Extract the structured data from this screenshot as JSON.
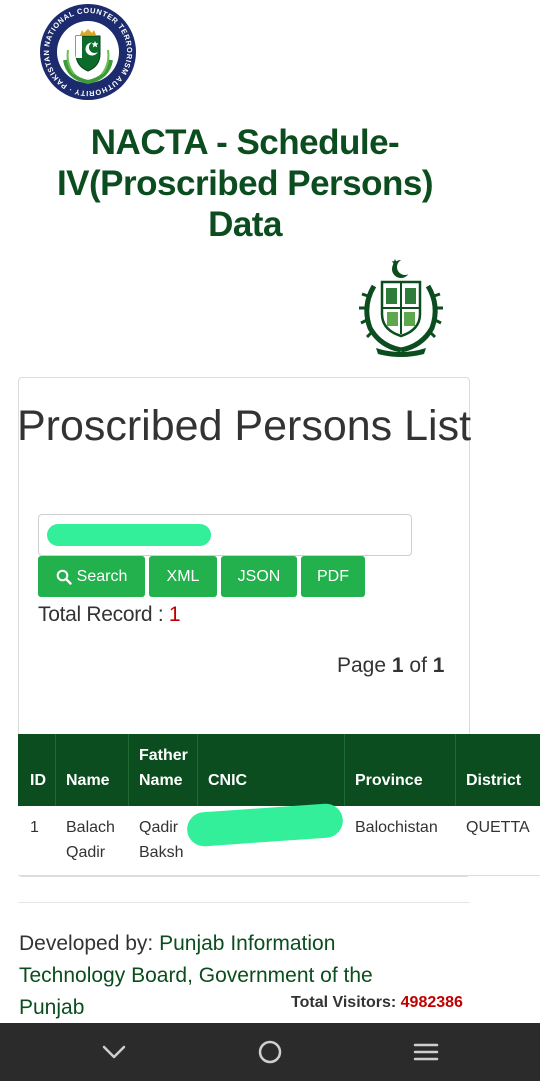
{
  "header": {
    "nacta_logo_text": "NATIONAL COUNTER TERRORISM AUTHORITY · PAKISTAN",
    "title": "NACTA - Schedule-IV(Proscribed Persons) Data"
  },
  "card": {
    "title": "Proscribed Persons List",
    "search": {
      "value": ""
    },
    "buttons": {
      "search": "Search",
      "xml": "XML",
      "json": "JSON",
      "pdf": "PDF"
    },
    "total_record_label": "Total Record : ",
    "total_record_value": "1",
    "pager": {
      "prefix": "Page ",
      "current": "1",
      "sep": " of ",
      "total": "1"
    }
  },
  "table": {
    "headers": {
      "id": "ID",
      "name": "Name",
      "father_top": "Father",
      "father_bottom": "Name",
      "cnic": "CNIC",
      "province": "Province",
      "district": "District"
    },
    "rows": [
      {
        "id": "1",
        "name_line1": "Balach",
        "name_line2": "Qadir",
        "father_line1": "Qadir",
        "father_line2": "Baksh",
        "cnic": "",
        "province": "Balochistan",
        "district": "QUETTA"
      }
    ]
  },
  "footer": {
    "developed_label": "Developed by: ",
    "developer": "Punjab Information Technology Board, Government of the Punjab",
    "visitors_label": "Total Visitors: ",
    "visitors_value": "4982386"
  },
  "colors": {
    "brand_green": "#0b4d1e",
    "button_green": "#22b14c",
    "accent_red": "#c00000",
    "redaction": "#33ef99"
  },
  "icons": {
    "nav_back": "chevron-down-icon",
    "nav_home": "circle-home-icon",
    "nav_menu": "menu-icon",
    "search": "search-icon"
  }
}
